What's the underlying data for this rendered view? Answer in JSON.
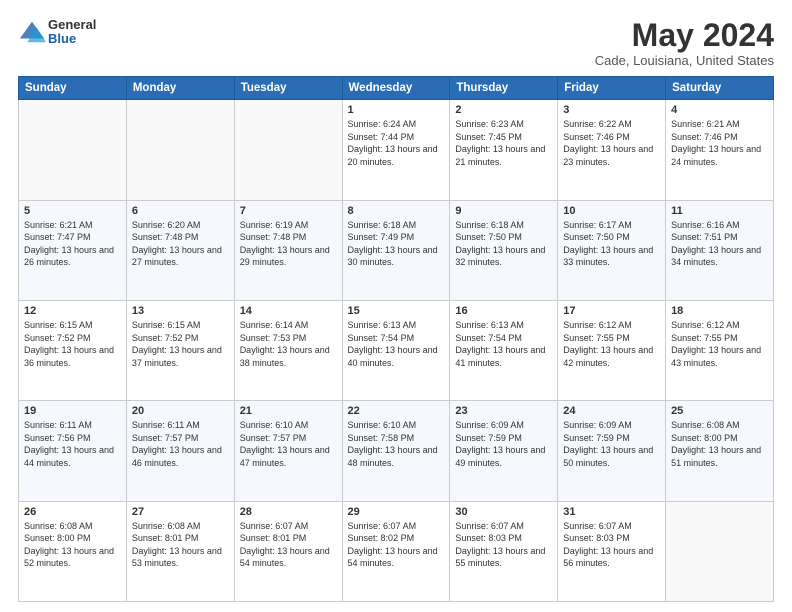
{
  "logo": {
    "general": "General",
    "blue": "Blue"
  },
  "title": "May 2024",
  "subtitle": "Cade, Louisiana, United States",
  "days_header": [
    "Sunday",
    "Monday",
    "Tuesday",
    "Wednesday",
    "Thursday",
    "Friday",
    "Saturday"
  ],
  "weeks": [
    [
      {
        "num": "",
        "info": ""
      },
      {
        "num": "",
        "info": ""
      },
      {
        "num": "",
        "info": ""
      },
      {
        "num": "1",
        "info": "Sunrise: 6:24 AM\nSunset: 7:44 PM\nDaylight: 13 hours\nand 20 minutes."
      },
      {
        "num": "2",
        "info": "Sunrise: 6:23 AM\nSunset: 7:45 PM\nDaylight: 13 hours\nand 21 minutes."
      },
      {
        "num": "3",
        "info": "Sunrise: 6:22 AM\nSunset: 7:46 PM\nDaylight: 13 hours\nand 23 minutes."
      },
      {
        "num": "4",
        "info": "Sunrise: 6:21 AM\nSunset: 7:46 PM\nDaylight: 13 hours\nand 24 minutes."
      }
    ],
    [
      {
        "num": "5",
        "info": "Sunrise: 6:21 AM\nSunset: 7:47 PM\nDaylight: 13 hours\nand 26 minutes."
      },
      {
        "num": "6",
        "info": "Sunrise: 6:20 AM\nSunset: 7:48 PM\nDaylight: 13 hours\nand 27 minutes."
      },
      {
        "num": "7",
        "info": "Sunrise: 6:19 AM\nSunset: 7:48 PM\nDaylight: 13 hours\nand 29 minutes."
      },
      {
        "num": "8",
        "info": "Sunrise: 6:18 AM\nSunset: 7:49 PM\nDaylight: 13 hours\nand 30 minutes."
      },
      {
        "num": "9",
        "info": "Sunrise: 6:18 AM\nSunset: 7:50 PM\nDaylight: 13 hours\nand 32 minutes."
      },
      {
        "num": "10",
        "info": "Sunrise: 6:17 AM\nSunset: 7:50 PM\nDaylight: 13 hours\nand 33 minutes."
      },
      {
        "num": "11",
        "info": "Sunrise: 6:16 AM\nSunset: 7:51 PM\nDaylight: 13 hours\nand 34 minutes."
      }
    ],
    [
      {
        "num": "12",
        "info": "Sunrise: 6:15 AM\nSunset: 7:52 PM\nDaylight: 13 hours\nand 36 minutes."
      },
      {
        "num": "13",
        "info": "Sunrise: 6:15 AM\nSunset: 7:52 PM\nDaylight: 13 hours\nand 37 minutes."
      },
      {
        "num": "14",
        "info": "Sunrise: 6:14 AM\nSunset: 7:53 PM\nDaylight: 13 hours\nand 38 minutes."
      },
      {
        "num": "15",
        "info": "Sunrise: 6:13 AM\nSunset: 7:54 PM\nDaylight: 13 hours\nand 40 minutes."
      },
      {
        "num": "16",
        "info": "Sunrise: 6:13 AM\nSunset: 7:54 PM\nDaylight: 13 hours\nand 41 minutes."
      },
      {
        "num": "17",
        "info": "Sunrise: 6:12 AM\nSunset: 7:55 PM\nDaylight: 13 hours\nand 42 minutes."
      },
      {
        "num": "18",
        "info": "Sunrise: 6:12 AM\nSunset: 7:55 PM\nDaylight: 13 hours\nand 43 minutes."
      }
    ],
    [
      {
        "num": "19",
        "info": "Sunrise: 6:11 AM\nSunset: 7:56 PM\nDaylight: 13 hours\nand 44 minutes."
      },
      {
        "num": "20",
        "info": "Sunrise: 6:11 AM\nSunset: 7:57 PM\nDaylight: 13 hours\nand 46 minutes."
      },
      {
        "num": "21",
        "info": "Sunrise: 6:10 AM\nSunset: 7:57 PM\nDaylight: 13 hours\nand 47 minutes."
      },
      {
        "num": "22",
        "info": "Sunrise: 6:10 AM\nSunset: 7:58 PM\nDaylight: 13 hours\nand 48 minutes."
      },
      {
        "num": "23",
        "info": "Sunrise: 6:09 AM\nSunset: 7:59 PM\nDaylight: 13 hours\nand 49 minutes."
      },
      {
        "num": "24",
        "info": "Sunrise: 6:09 AM\nSunset: 7:59 PM\nDaylight: 13 hours\nand 50 minutes."
      },
      {
        "num": "25",
        "info": "Sunrise: 6:08 AM\nSunset: 8:00 PM\nDaylight: 13 hours\nand 51 minutes."
      }
    ],
    [
      {
        "num": "26",
        "info": "Sunrise: 6:08 AM\nSunset: 8:00 PM\nDaylight: 13 hours\nand 52 minutes."
      },
      {
        "num": "27",
        "info": "Sunrise: 6:08 AM\nSunset: 8:01 PM\nDaylight: 13 hours\nand 53 minutes."
      },
      {
        "num": "28",
        "info": "Sunrise: 6:07 AM\nSunset: 8:01 PM\nDaylight: 13 hours\nand 54 minutes."
      },
      {
        "num": "29",
        "info": "Sunrise: 6:07 AM\nSunset: 8:02 PM\nDaylight: 13 hours\nand 54 minutes."
      },
      {
        "num": "30",
        "info": "Sunrise: 6:07 AM\nSunset: 8:03 PM\nDaylight: 13 hours\nand 55 minutes."
      },
      {
        "num": "31",
        "info": "Sunrise: 6:07 AM\nSunset: 8:03 PM\nDaylight: 13 hours\nand 56 minutes."
      },
      {
        "num": "",
        "info": ""
      }
    ]
  ]
}
